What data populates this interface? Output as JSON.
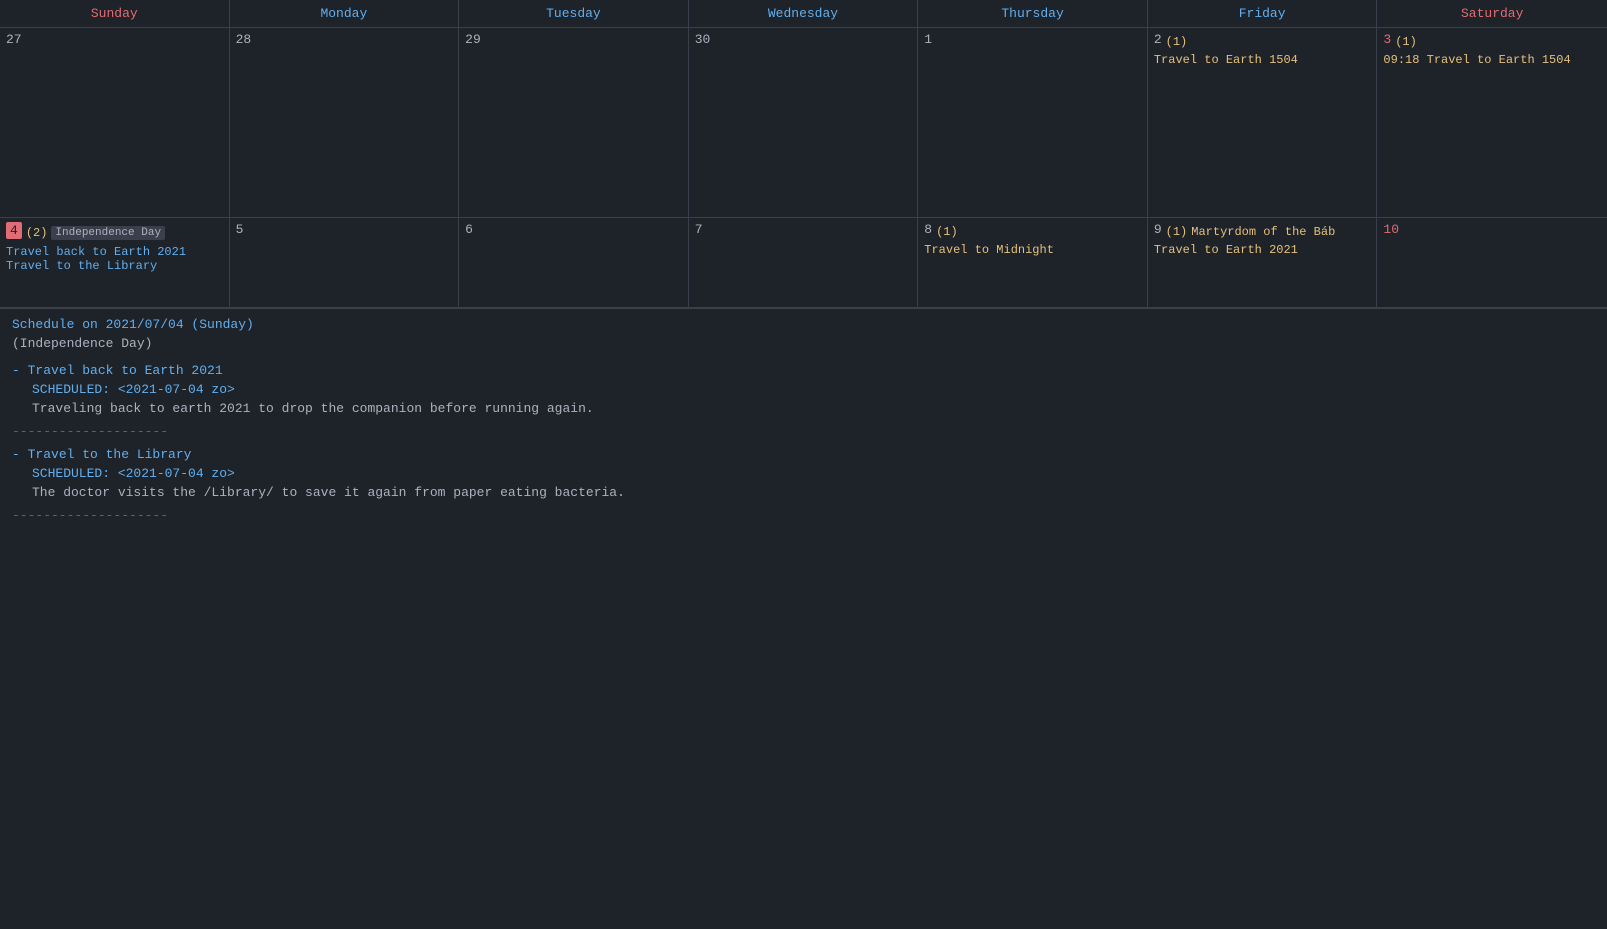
{
  "calendar": {
    "headers": [
      {
        "label": "Sunday",
        "class": "col-sunday"
      },
      {
        "label": "Monday",
        "class": "col-monday"
      },
      {
        "label": "Tuesday",
        "class": "col-tuesday"
      },
      {
        "label": "Wednesday",
        "class": "col-wednesday"
      },
      {
        "label": "Thursday",
        "class": "col-thursday"
      },
      {
        "label": "Friday",
        "class": "col-friday"
      },
      {
        "label": "Saturday",
        "class": "col-saturday"
      }
    ],
    "week1": [
      {
        "day": "27",
        "dayClass": ""
      },
      {
        "day": "28",
        "dayClass": ""
      },
      {
        "day": "29",
        "dayClass": ""
      },
      {
        "day": "30",
        "dayClass": ""
      },
      {
        "day": "1",
        "dayClass": ""
      },
      {
        "day": "2",
        "dayClass": "",
        "count": "(1)",
        "events": [
          {
            "label": "Travel to Earth 1504",
            "class": "event-orange"
          }
        ]
      },
      {
        "day": "3",
        "dayClass": "saturday",
        "count": "(1)",
        "timePrefix": "09:18",
        "events": [
          {
            "label": "Travel to Earth 1504",
            "class": "event-orange"
          }
        ]
      }
    ],
    "week2": [
      {
        "day": "4",
        "dayClass": "today",
        "holiday": "Independence Day",
        "count": "(2)",
        "events": [
          {
            "label": "Travel back to Earth 2021",
            "class": "event-blue"
          },
          {
            "label": "Travel to the Library",
            "class": "event-blue"
          }
        ]
      },
      {
        "day": "5",
        "dayClass": ""
      },
      {
        "day": "6",
        "dayClass": ""
      },
      {
        "day": "7",
        "dayClass": ""
      },
      {
        "day": "8",
        "dayClass": "",
        "count": "(1)",
        "events": [
          {
            "label": "Travel to Midnight",
            "class": "event-orange"
          }
        ]
      },
      {
        "day": "9",
        "dayClass": "",
        "count": "(1)",
        "holiday": "Martyrdom of the Báb",
        "events": [
          {
            "label": "Travel to Earth 2021",
            "class": "event-orange"
          }
        ]
      },
      {
        "day": "10",
        "dayClass": "saturday"
      }
    ]
  },
  "schedule": {
    "header": "Schedule on 2021/07/04 (Sunday)",
    "holiday": "(Independence Day)",
    "items": [
      {
        "title": "Travel back to Earth 2021",
        "scheduled": "SCHEDULED: <2021-07-04 zo>",
        "description": "Traveling back to earth 2021 to drop the companion before running again."
      },
      {
        "title": "Travel to the Library",
        "scheduled": "SCHEDULED: <2021-07-04 zo>",
        "description": "The doctor visits the /Library/ to save it again from paper eating bacteria."
      }
    ],
    "divider": "--------------------"
  }
}
